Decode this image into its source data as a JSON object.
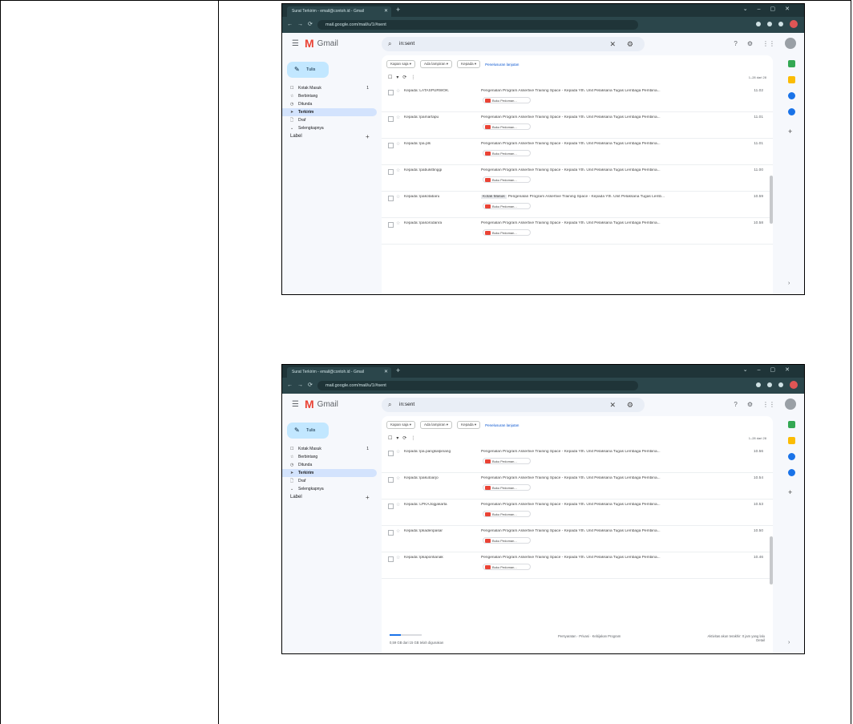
{
  "shots": [
    {
      "tab_title": "Surat Terkirim - email@contoh.id - Gmail",
      "url": "mail.google.com/mail/u/1/#sent",
      "app_name": "Gmail",
      "search_text": "in:sent",
      "compose_label": "Tulis",
      "nav": [
        {
          "icon": "☐",
          "label": "Kotak Masuk",
          "count": "1",
          "active": false
        },
        {
          "icon": "☆",
          "label": "Berbintang",
          "count": "",
          "active": false
        },
        {
          "icon": "◷",
          "label": "Ditunda",
          "count": "",
          "active": false
        },
        {
          "icon": "➤",
          "label": "Terkirim",
          "count": "",
          "active": true
        },
        {
          "icon": "🗋",
          "label": "Draf",
          "count": "",
          "active": false
        },
        {
          "icon": "⌄",
          "label": "Selengkapnya",
          "count": "",
          "active": false
        }
      ],
      "label_header": "Label",
      "filters": [
        "Kapan saja",
        "Ada lampiran",
        "Kepada"
      ],
      "filter_link": "Penelusuran lanjutan",
      "pagination": "1–28 dari 28",
      "rows": [
        {
          "to": "Kepada: LATASPURWOK.",
          "badge": "",
          "subject": "Pengenalan Program Assertive Training Space - Kepada Yth. Unit Pelaksana Tugas Lembaga Pembina...",
          "time": "11.02",
          "attachment": "Buku Pedoman..."
        },
        {
          "to": "Kepada: lpamartapu",
          "badge": "",
          "subject": "Pengenalan Program Assertive Training Space - Kepada Yth. Unit Pelaksana Tugas Lembaga Pembina...",
          "time": "11.01",
          "attachment": "Buku Pedoman..."
        },
        {
          "to": "Kepada: lpa.pls",
          "badge": "",
          "subject": "Pengenalan Program Assertive Training Space - Kepada Yth. Unit Pelaksana Tugas Lembaga Pembina...",
          "time": "11.01",
          "attachment": "Buku Pedoman..."
        },
        {
          "to": "Kepada: lpabukittinggi",
          "badge": "",
          "subject": "Pengenalan Program Assertive Training Space - Kepada Yth. Unit Pelaksana Tugas Lembaga Pembina...",
          "time": "11.00",
          "attachment": "Buku Pedoman..."
        },
        {
          "to": "Kepada: lpakotabaru",
          "badge": "Kotak Masuk",
          "subject": "Pengenalan Program Assertive Training Space - Kepada Yth. Unit Pelaksana Tugas Lemb...",
          "time": "10.59",
          "attachment": "Buku Pedoman..."
        },
        {
          "to": "Kepada: lpasorodanra",
          "badge": "",
          "subject": "Pengenalan Program Assertive Training Space - Kepada Yth. Unit Pelaksana Tugas Lembaga Pembina...",
          "time": "10.58",
          "attachment": "Buku Pedoman..."
        }
      ],
      "show_footer": false
    },
    {
      "tab_title": "Surat Terkirim - email@contoh.id - Gmail",
      "url": "mail.google.com/mail/u/1/#sent",
      "app_name": "Gmail",
      "search_text": "in:sent",
      "compose_label": "Tulis",
      "nav": [
        {
          "icon": "☐",
          "label": "Kotak Masuk",
          "count": "1",
          "active": false
        },
        {
          "icon": "☆",
          "label": "Berbintang",
          "count": "",
          "active": false
        },
        {
          "icon": "◷",
          "label": "Ditunda",
          "count": "",
          "active": false
        },
        {
          "icon": "➤",
          "label": "Terkirim",
          "count": "",
          "active": true
        },
        {
          "icon": "🗋",
          "label": "Draf",
          "count": "",
          "active": false
        },
        {
          "icon": "⌄",
          "label": "Selengkapnya",
          "count": "",
          "active": false
        }
      ],
      "label_header": "Label",
      "filters": [
        "Kapan saja",
        "Ada lampiran",
        "Kepada"
      ],
      "filter_link": "Penelusuran lanjutan",
      "pagination": "1–28 dari 28",
      "rows": [
        {
          "to": "Kepada: lpa.pangkalpinang",
          "badge": "",
          "subject": "Pengenalan Program Assertive Training Space - Kepada Yth. Unit Pelaksana Tugas Lembaga Pembina...",
          "time": "10.56",
          "attachment": "Buku Pedoman..."
        },
        {
          "to": "Kepada: lpakutoarjo",
          "badge": "",
          "subject": "Pengenalan Program Assertive Training Space - Kepada Yth. Unit Pelaksana Tugas Lembaga Pembina...",
          "time": "10.54",
          "attachment": "Buku Pedoman..."
        },
        {
          "to": "Kepada: LPKAJogjakarta",
          "badge": "",
          "subject": "Pengenalan Program Assertive Training Space - Kepada Yth. Unit Pelaksana Tugas Lembaga Pembina...",
          "time": "10.53",
          "attachment": "Buku Pedoman..."
        },
        {
          "to": "Kepada: lpkadenpasar",
          "badge": "",
          "subject": "Pengenalan Program Assertive Training Space - Kepada Yth. Unit Pelaksana Tugas Lembaga Pembina...",
          "time": "10.50",
          "attachment": "Buku Pedoman..."
        },
        {
          "to": "Kepada: lpkapontianak",
          "badge": "",
          "subject": "Pengenalan Program Assertive Training Space - Kepada Yth. Unit Pelaksana Tugas Lembaga Pembina...",
          "time": "10.46",
          "attachment": "Buku Pedoman..."
        }
      ],
      "show_footer": true,
      "footer": {
        "storage_fraction": 0.35,
        "storage_text": "0,59 GB dari 15 GB telah digunakan",
        "middle": "Persyaratan · Privasi · Kebijakan Program",
        "right_line1": "Aktivitas akun terakhir: 0 jam yang lalu",
        "right_line2": "Detail"
      }
    }
  ],
  "colors": {
    "chrome_dark": "#1f3438",
    "chrome_mid": "#2b464b",
    "gmail_bg": "#f6f8fc",
    "compose_bg": "#c2e7ff",
    "active_nav": "#d3e3fd",
    "pdf_red": "#ea4335",
    "link_blue": "#0b57d0"
  }
}
